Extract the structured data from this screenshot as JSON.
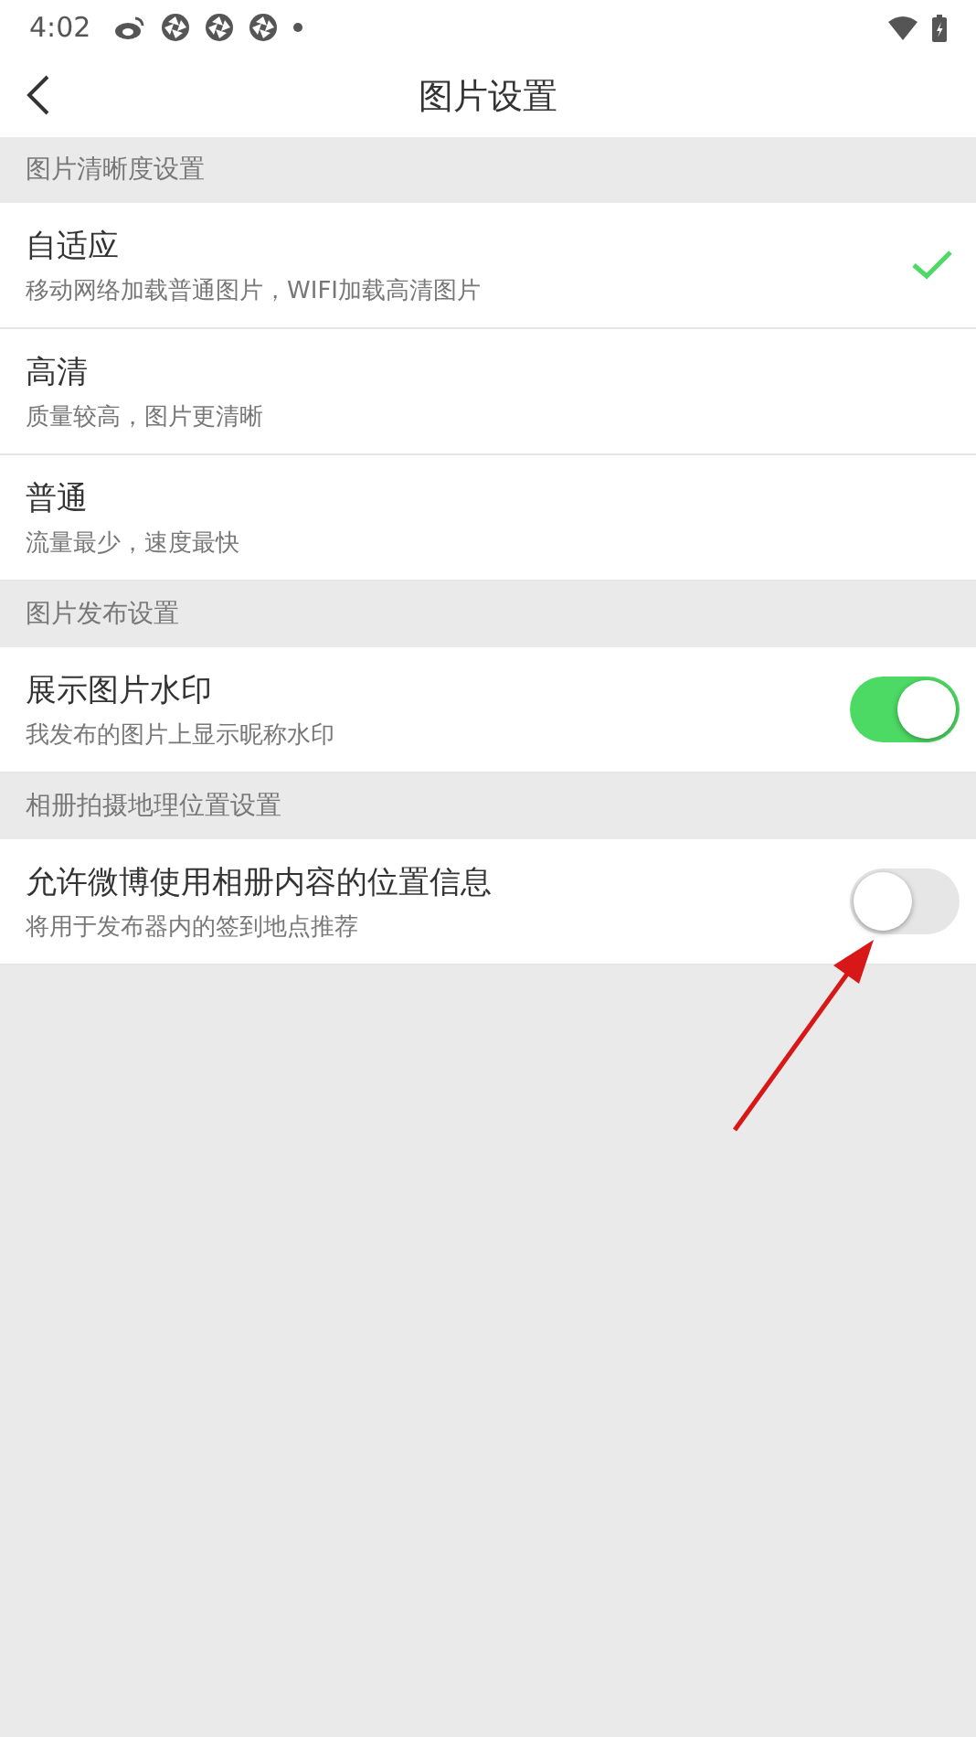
{
  "status_bar": {
    "time": "4:02"
  },
  "header": {
    "title": "图片设置"
  },
  "sections": [
    {
      "title": "图片清晰度设置",
      "items": [
        {
          "kind": "option",
          "title": "自适应",
          "subtitle": "移动网络加载普通图片，WIFI加载高清图片",
          "selected": true
        },
        {
          "kind": "option",
          "title": "高清",
          "subtitle": "质量较高，图片更清晰",
          "selected": false
        },
        {
          "kind": "option",
          "title": "普通",
          "subtitle": "流量最少，速度最快",
          "selected": false
        }
      ]
    },
    {
      "title": "图片发布设置",
      "items": [
        {
          "kind": "toggle",
          "title": "展示图片水印",
          "subtitle": "我发布的图片上显示昵称水印",
          "on": true
        }
      ]
    },
    {
      "title": "相册拍摄地理位置设置",
      "items": [
        {
          "kind": "toggle",
          "title": "允许微博使用相册内容的位置信息",
          "subtitle": "将用于发布器内的签到地点推荐",
          "on": false
        }
      ]
    }
  ]
}
